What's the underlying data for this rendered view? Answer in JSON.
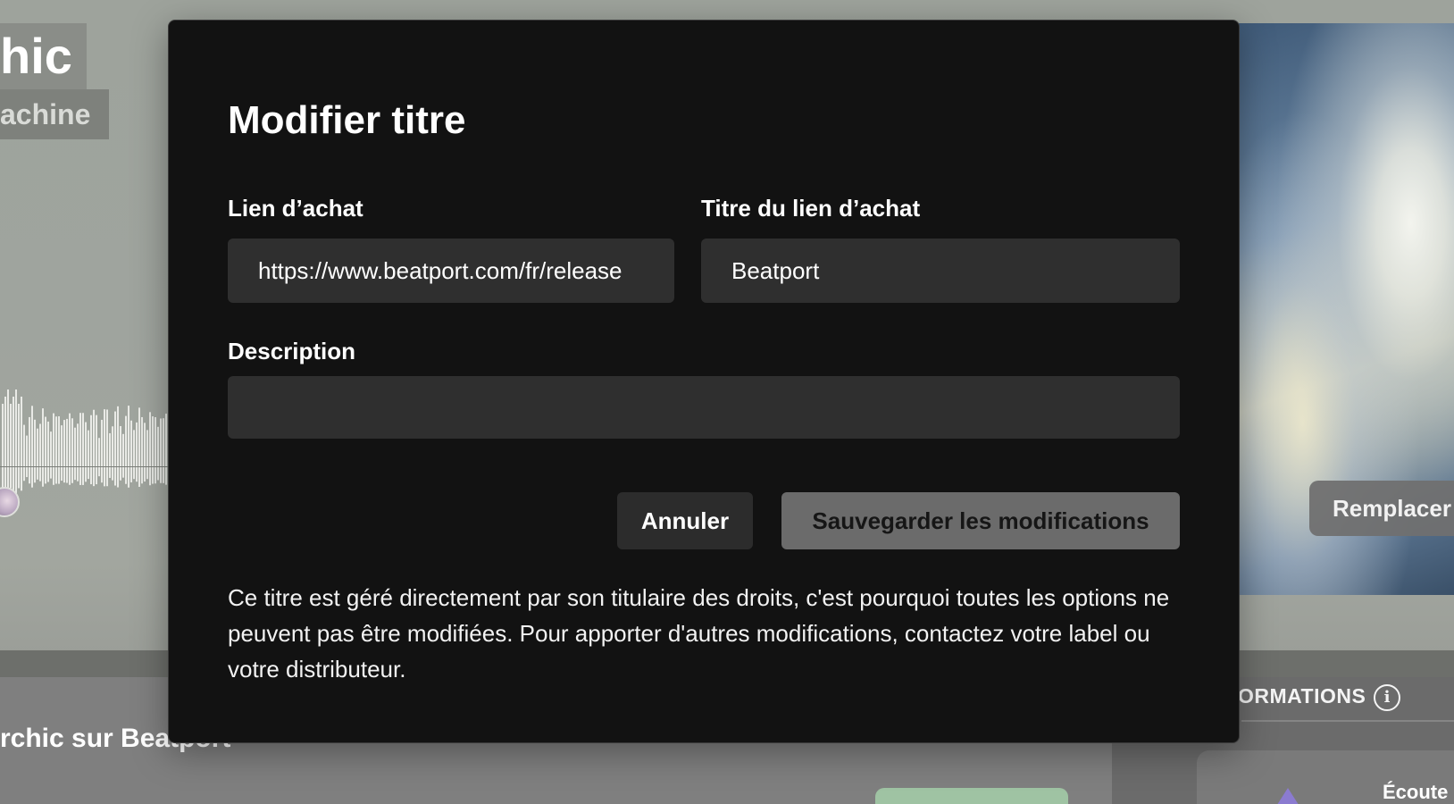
{
  "background": {
    "hero_title": "hic",
    "hero_subtitle": "achine",
    "replace_button": "Remplacer",
    "lower_title": "rchic sur Beatport",
    "info_title": "ORMATIONS",
    "card_label": "Écoute"
  },
  "modal": {
    "title": "Modifier titre",
    "purchase_link_label": "Lien d’achat",
    "purchase_link_value": "https://www.beatport.com/fr/release",
    "purchase_title_label": "Titre du lien d’achat",
    "purchase_title_value": "Beatport",
    "description_label": "Description",
    "description_value": "",
    "cancel_label": "Annuler",
    "save_label": "Sauvegarder les modifications",
    "note": "Ce titre est géré directement par son titulaire des droits, c'est pourquoi toutes les options ne peuvent pas être modifiées. Pour apporter d'autres modifications, contactez votre label ou votre distributeur."
  },
  "colors": {
    "modal_bg": "#121212",
    "input_bg": "#2f2f2f",
    "save_button_bg": "#6b6b6b",
    "cancel_button_bg": "#2c2c2c"
  }
}
